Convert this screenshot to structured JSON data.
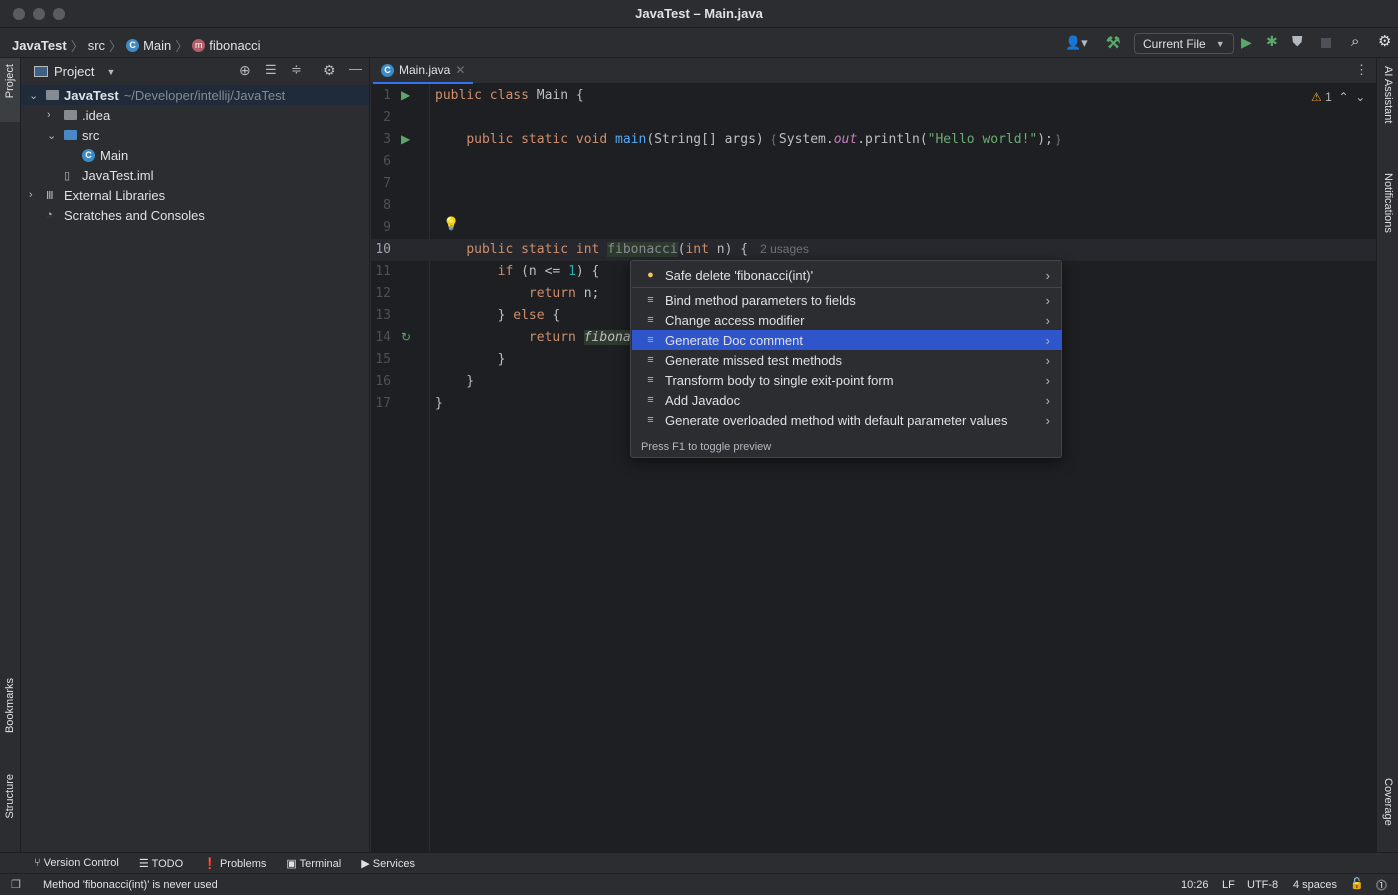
{
  "window": {
    "title": "JavaTest – Main.java"
  },
  "breadcrumb": [
    "JavaTest",
    "src",
    "Main",
    "fibonacci"
  ],
  "toolbar": {
    "run_config": "Current File"
  },
  "project_panel": {
    "title": "Project",
    "tree": [
      {
        "label": "JavaTest",
        "path": "~/Developer/intellij/JavaTest",
        "depth": 0,
        "expanded": true,
        "icon": "module-folder-icon"
      },
      {
        "label": ".idea",
        "depth": 1,
        "expanded": false,
        "icon": "folder-icon"
      },
      {
        "label": "src",
        "depth": 1,
        "expanded": true,
        "icon": "source-folder-icon"
      },
      {
        "label": "Main",
        "depth": 2,
        "icon": "class-icon"
      },
      {
        "label": "JavaTest.iml",
        "depth": 1,
        "icon": "file-icon"
      },
      {
        "label": "External Libraries",
        "depth": 0,
        "expanded": false,
        "icon": "library-icon"
      },
      {
        "label": "Scratches and Consoles",
        "depth": 0,
        "icon": "scratch-icon"
      }
    ]
  },
  "left_strip": {
    "top": "Project",
    "bottom1": "Bookmarks",
    "bottom2": "Structure"
  },
  "right_strip": {
    "top1": "AI Assistant",
    "top2": "Notifications",
    "bottom": "Coverage"
  },
  "editor": {
    "tab": "Main.java",
    "warnings": "1",
    "inlay_usages": "2 usages",
    "lines": [
      {
        "n": "1",
        "code": [
          [
            "kw",
            "public class "
          ],
          [
            "pl",
            "Main {"
          ]
        ]
      },
      {
        "n": "2",
        "code": []
      },
      {
        "n": "3",
        "code": [
          [
            "pl",
            "    "
          ],
          [
            "kw",
            "public static void "
          ],
          [
            "fn",
            "main"
          ],
          [
            "pl",
            "(String[] args) "
          ],
          [
            "gray",
            "{ "
          ],
          [
            "pl",
            "System."
          ],
          [
            "it",
            "out"
          ],
          [
            "pl",
            ".println("
          ],
          [
            "st",
            "\"Hello world!\""
          ],
          [
            "pl",
            ");"
          ],
          [
            "gray",
            " }"
          ]
        ]
      },
      {
        "n": "6",
        "code": []
      },
      {
        "n": "7",
        "code": []
      },
      {
        "n": "8",
        "code": []
      },
      {
        "n": "9",
        "code": []
      },
      {
        "n": "10",
        "code": [
          [
            "pl",
            "    "
          ],
          [
            "kw",
            "public static int "
          ],
          [
            "unused",
            "fibonacci"
          ],
          [
            "pl",
            "("
          ],
          [
            "kw",
            "int "
          ],
          [
            "pl",
            "n) {"
          ]
        ]
      },
      {
        "n": "11",
        "code": [
          [
            "pl",
            "        "
          ],
          [
            "kw",
            "if "
          ],
          [
            "pl",
            "(n <= "
          ],
          [
            "num",
            "1"
          ],
          [
            "pl",
            ") {"
          ]
        ]
      },
      {
        "n": "12",
        "code": [
          [
            "pl",
            "            "
          ],
          [
            "kw",
            "return "
          ],
          [
            "pl",
            "n;"
          ]
        ]
      },
      {
        "n": "13",
        "code": [
          [
            "pl",
            "        } "
          ],
          [
            "kw",
            "else "
          ],
          [
            "pl",
            "{"
          ]
        ]
      },
      {
        "n": "14",
        "code": [
          [
            "pl",
            "            "
          ],
          [
            "kw",
            "return "
          ],
          [
            "fi",
            "fibona"
          ]
        ]
      },
      {
        "n": "15",
        "code": [
          [
            "pl",
            "        }"
          ]
        ]
      },
      {
        "n": "16",
        "code": [
          [
            "pl",
            "    }"
          ]
        ]
      },
      {
        "n": "17",
        "code": [
          [
            "pl",
            "}"
          ]
        ]
      }
    ]
  },
  "popup": {
    "items": [
      {
        "label": "Safe delete 'fibonacci(int)'",
        "icon": "bulb-icon"
      },
      {
        "label": "Bind method parameters to fields",
        "icon": "intention-icon"
      },
      {
        "label": "Change access modifier",
        "icon": "intention-icon"
      },
      {
        "label": "Generate Doc comment",
        "icon": "intention-icon",
        "selected": true
      },
      {
        "label": "Generate missed test methods",
        "icon": "intention-icon"
      },
      {
        "label": "Transform body to single exit-point form",
        "icon": "intention-icon"
      },
      {
        "label": "Add Javadoc",
        "icon": "intention-icon"
      },
      {
        "label": "Generate overloaded method with default parameter values",
        "icon": "intention-icon"
      }
    ],
    "footer": "Press F1 to toggle preview"
  },
  "tool_windows": [
    "Version Control",
    "TODO",
    "Problems",
    "Terminal",
    "Services"
  ],
  "status": {
    "message": "Method 'fibonacci(int)' is never used",
    "position": "10:26",
    "line_sep": "LF",
    "encoding": "UTF-8",
    "indent": "4 spaces"
  },
  "colors": {
    "accent": "#3574f0",
    "selection": "#2e55c9",
    "keyword": "#cf8e6d",
    "string": "#6aab73",
    "run": "#59a869"
  }
}
